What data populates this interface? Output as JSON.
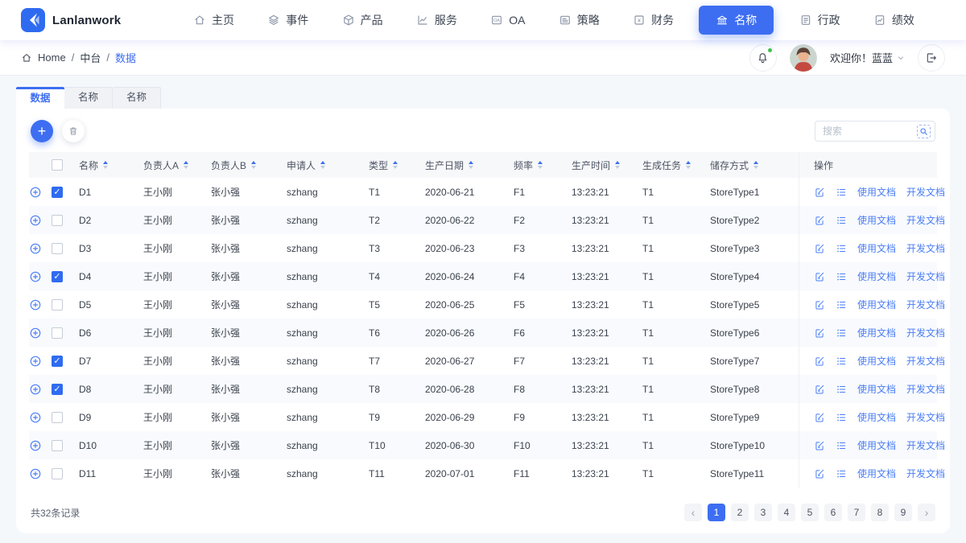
{
  "colors": {
    "primary": "#3d6ef2",
    "link": "#4a7df5"
  },
  "brand": {
    "name": "Lanlanwork"
  },
  "nav": {
    "items": [
      {
        "icon": "home-icon",
        "label": "主页",
        "active": false
      },
      {
        "icon": "layers-icon",
        "label": "事件",
        "active": false
      },
      {
        "icon": "box-icon",
        "label": "产品",
        "active": false
      },
      {
        "icon": "chart-icon",
        "label": "服务",
        "active": false
      },
      {
        "icon": "oa-icon",
        "label": "OA",
        "active": false
      },
      {
        "icon": "strategy-icon",
        "label": "策略",
        "active": false
      },
      {
        "icon": "finance-icon",
        "label": "财务",
        "active": false
      },
      {
        "icon": "bank-icon",
        "label": "名称",
        "active": true
      },
      {
        "icon": "admin-icon",
        "label": "行政",
        "active": false
      },
      {
        "icon": "performance-icon",
        "label": "绩效",
        "active": false
      }
    ]
  },
  "breadcrumb": {
    "separator": "/",
    "items": [
      {
        "label": "Home",
        "current": false
      },
      {
        "label": "中台",
        "current": false
      },
      {
        "label": "数据",
        "current": true
      }
    ]
  },
  "user": {
    "welcome": "欢迎你！蓝蓝"
  },
  "tabs": [
    {
      "label": "数据",
      "active": true
    },
    {
      "label": "名称",
      "active": false
    },
    {
      "label": "名称",
      "active": false
    }
  ],
  "search": {
    "placeholder": "搜索"
  },
  "table": {
    "columns": [
      {
        "label": "名称",
        "sortable": true
      },
      {
        "label": "负责人A",
        "sortable": true
      },
      {
        "label": "负责人B",
        "sortable": true
      },
      {
        "label": "申请人",
        "sortable": true
      },
      {
        "label": "类型",
        "sortable": true
      },
      {
        "label": "生产日期",
        "sortable": true
      },
      {
        "label": "频率",
        "sortable": true
      },
      {
        "label": "生产时间",
        "sortable": true
      },
      {
        "label": "生成任务",
        "sortable": true
      },
      {
        "label": "储存方式",
        "sortable": true
      }
    ],
    "actions_header": "操作",
    "action_labels": {
      "usage_doc": "使用文档",
      "dev_doc": "开发文档"
    },
    "rows": [
      {
        "checked": true,
        "name": "D1",
        "owner_a": "王小刚",
        "owner_b": "张小强",
        "applicant": "szhang",
        "type": "T1",
        "prod_date": "2020-06-21",
        "freq": "F1",
        "prod_time": "13:23:21",
        "gen_task": "T1",
        "store": "StoreType1"
      },
      {
        "checked": false,
        "name": "D2",
        "owner_a": "王小刚",
        "owner_b": "张小强",
        "applicant": "szhang",
        "type": "T2",
        "prod_date": "2020-06-22",
        "freq": "F2",
        "prod_time": "13:23:21",
        "gen_task": "T1",
        "store": "StoreType2"
      },
      {
        "checked": false,
        "name": "D3",
        "owner_a": "王小刚",
        "owner_b": "张小强",
        "applicant": "szhang",
        "type": "T3",
        "prod_date": "2020-06-23",
        "freq": "F3",
        "prod_time": "13:23:21",
        "gen_task": "T1",
        "store": "StoreType3"
      },
      {
        "checked": true,
        "name": "D4",
        "owner_a": "王小刚",
        "owner_b": "张小强",
        "applicant": "szhang",
        "type": "T4",
        "prod_date": "2020-06-24",
        "freq": "F4",
        "prod_time": "13:23:21",
        "gen_task": "T1",
        "store": "StoreType4"
      },
      {
        "checked": false,
        "name": "D5",
        "owner_a": "王小刚",
        "owner_b": "张小强",
        "applicant": "szhang",
        "type": "T5",
        "prod_date": "2020-06-25",
        "freq": "F5",
        "prod_time": "13:23:21",
        "gen_task": "T1",
        "store": "StoreType5"
      },
      {
        "checked": false,
        "name": "D6",
        "owner_a": "王小刚",
        "owner_b": "张小强",
        "applicant": "szhang",
        "type": "T6",
        "prod_date": "2020-06-26",
        "freq": "F6",
        "prod_time": "13:23:21",
        "gen_task": "T1",
        "store": "StoreType6"
      },
      {
        "checked": true,
        "name": "D7",
        "owner_a": "王小刚",
        "owner_b": "张小强",
        "applicant": "szhang",
        "type": "T7",
        "prod_date": "2020-06-27",
        "freq": "F7",
        "prod_time": "13:23:21",
        "gen_task": "T1",
        "store": "StoreType7"
      },
      {
        "checked": true,
        "name": "D8",
        "owner_a": "王小刚",
        "owner_b": "张小强",
        "applicant": "szhang",
        "type": "T8",
        "prod_date": "2020-06-28",
        "freq": "F8",
        "prod_time": "13:23:21",
        "gen_task": "T1",
        "store": "StoreType8"
      },
      {
        "checked": false,
        "name": "D9",
        "owner_a": "王小刚",
        "owner_b": "张小强",
        "applicant": "szhang",
        "type": "T9",
        "prod_date": "2020-06-29",
        "freq": "F9",
        "prod_time": "13:23:21",
        "gen_task": "T1",
        "store": "StoreType9"
      },
      {
        "checked": false,
        "name": "D10",
        "owner_a": "王小刚",
        "owner_b": "张小强",
        "applicant": "szhang",
        "type": "T10",
        "prod_date": "2020-06-30",
        "freq": "F10",
        "prod_time": "13:23:21",
        "gen_task": "T1",
        "store": "StoreType10"
      },
      {
        "checked": false,
        "name": "D11",
        "owner_a": "王小刚",
        "owner_b": "张小强",
        "applicant": "szhang",
        "type": "T11",
        "prod_date": "2020-07-01",
        "freq": "F11",
        "prod_time": "13:23:21",
        "gen_task": "T1",
        "store": "StoreType11"
      }
    ]
  },
  "footer": {
    "total": "共32条记录",
    "pagination": {
      "prev": "‹",
      "pages": [
        "1",
        "2",
        "3",
        "4",
        "5",
        "6",
        "7",
        "8",
        "9"
      ],
      "active": "1",
      "next": "›"
    }
  }
}
